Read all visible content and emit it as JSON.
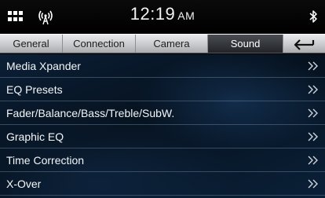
{
  "status": {
    "time": "12:19",
    "meridiem": "AM"
  },
  "tabs": [
    {
      "label": "General",
      "active": false
    },
    {
      "label": "Connection",
      "active": false
    },
    {
      "label": "Camera",
      "active": false
    },
    {
      "label": "Sound",
      "active": true
    }
  ],
  "menu": {
    "items": [
      {
        "label": "Media Xpander"
      },
      {
        "label": "EQ Presets"
      },
      {
        "label": "Fader/Balance/Bass/Treble/SubW."
      },
      {
        "label": "Graphic EQ"
      },
      {
        "label": "Time Correction"
      },
      {
        "label": "X-Over"
      }
    ]
  },
  "icons": {
    "apps": "grid-icon",
    "signal": "antenna-signal-icon",
    "bluetooth": "bluetooth-icon",
    "back": "back-arrow-icon",
    "chevron": "double-chevron-right-icon"
  },
  "colors": {
    "tab_bar": "#c8cacd",
    "active_tab": "#2a2d31",
    "menu_background": "#0b1f36"
  }
}
